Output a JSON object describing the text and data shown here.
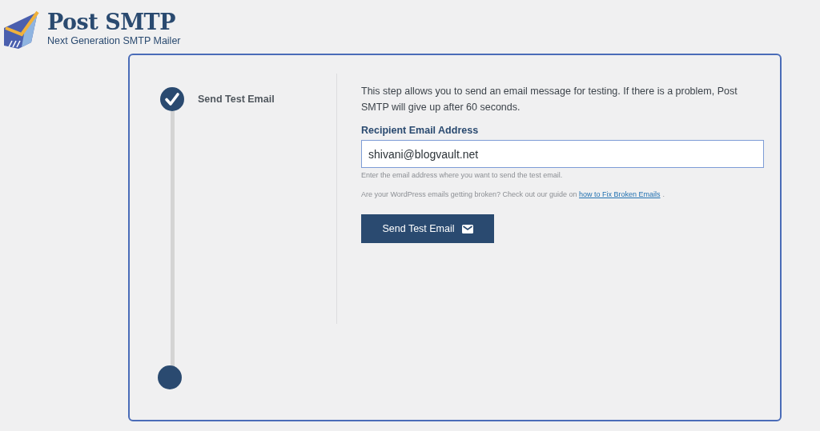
{
  "logo": {
    "title": "Post SMTP",
    "tagline": "Next Generation SMTP Mailer"
  },
  "steps": [
    {
      "label": "Send Test Email",
      "completed": true
    },
    {
      "completed": false
    }
  ],
  "form": {
    "intro": "This step allows you to send an email message for testing. If there is a problem, Post SMTP will give up after 60 seconds.",
    "field_label": "Recipient Email Address",
    "value": "shivani@blogvault.net",
    "help": "Enter the email address where you want to send the test email.",
    "guide_text": "Are your WordPress emails getting broken? Check out our guide on",
    "guide_link": "how to Fix Broken Emails",
    "guide_end": ".",
    "button": "Send Test Email"
  }
}
